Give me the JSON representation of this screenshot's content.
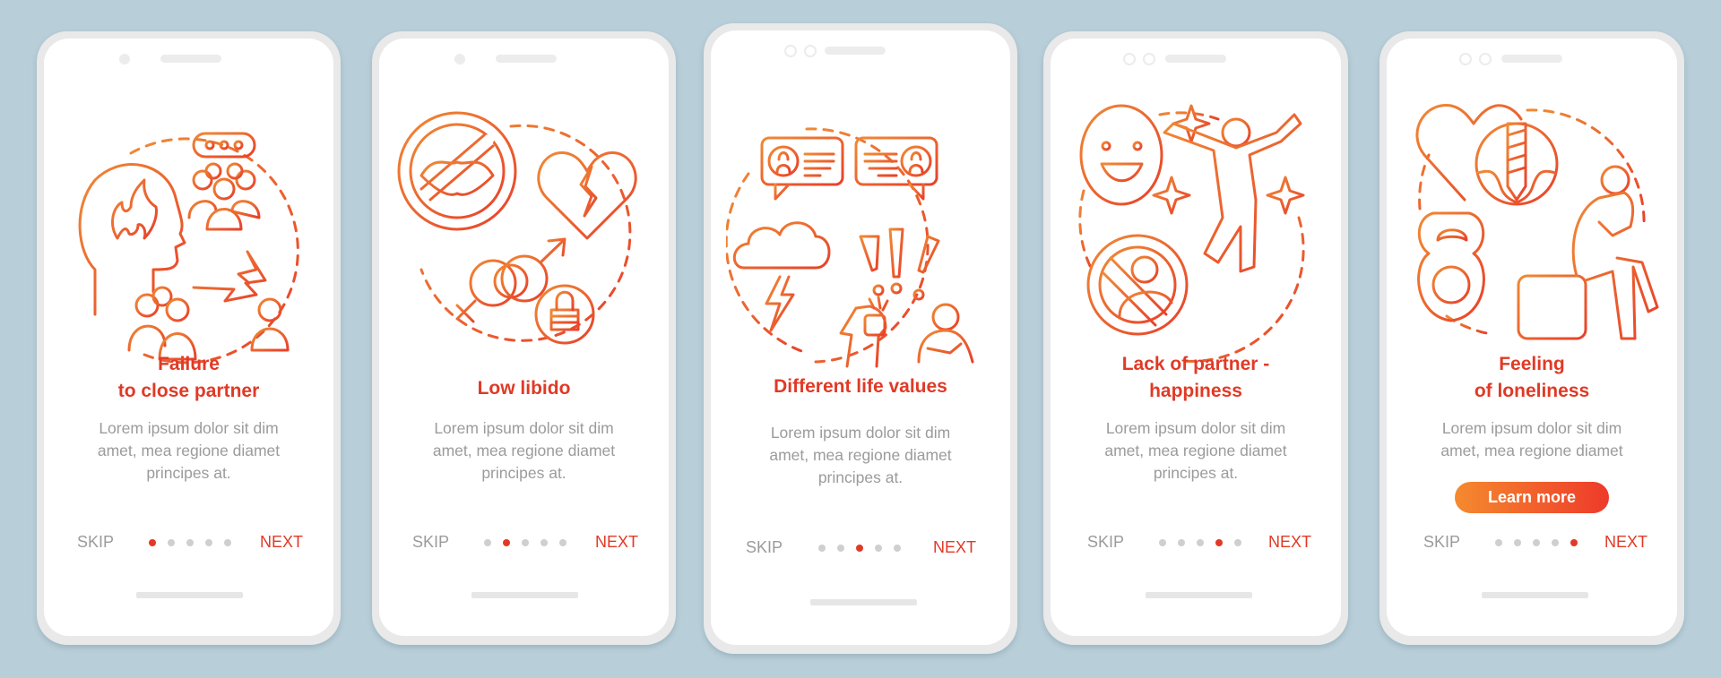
{
  "colors": {
    "background": "#b8ced8",
    "accent": "#e03a26",
    "icon_gradient_start": "#f08a35",
    "icon_gradient_end": "#e8402a",
    "body_text": "#9b9b9b",
    "dot_inactive": "#cfcfcf"
  },
  "screens": [
    {
      "title_lines": [
        "Failure",
        "to close partner"
      ],
      "body_lines": [
        "Lorem ipsum dolor sit dim",
        "amet, mea regione diamet",
        "principes at."
      ],
      "illustration": [
        "head-with-fire-icon",
        "group-with-speech-bubble-icon",
        "lightning-conflict-icon",
        "group-icon",
        "person-icon"
      ],
      "skip_label": "SKIP",
      "next_label": "NEXT",
      "active_page": 1,
      "total_pages": 5
    },
    {
      "title_lines": [
        "Low libido"
      ],
      "body_lines": [
        "Lorem ipsum dolor sit dim",
        "amet, mea regione diamet",
        "principes at."
      ],
      "illustration": [
        "no-kiss-icon",
        "broken-heart-icon",
        "gender-symbols-icon",
        "lock-icon"
      ],
      "skip_label": "SKIP",
      "next_label": "NEXT",
      "active_page": 2,
      "total_pages": 5
    },
    {
      "title_lines": [
        "Different life values"
      ],
      "body_lines": [
        "Lorem ipsum dolor sit dim",
        "amet, mea regione diamet",
        "principes at."
      ],
      "illustration": [
        "profile-chat-bubbles-icon",
        "storm-cloud-icon",
        "exclamation-marks-icon",
        "arguing-people-icon"
      ],
      "skip_label": "SKIP",
      "next_label": "NEXT",
      "active_page": 3,
      "total_pages": 5
    },
    {
      "title_lines": [
        "Lack of partner -",
        "happiness"
      ],
      "body_lines": [
        "Lorem ipsum dolor sit dim",
        "amet, mea regione diamet",
        "principes at."
      ],
      "illustration": [
        "smiley-face-icon",
        "jumping-person-icon",
        "sparkles-icon",
        "no-person-icon"
      ],
      "skip_label": "SKIP",
      "next_label": "NEXT",
      "active_page": 4,
      "total_pages": 5
    },
    {
      "title_lines": [
        "Feeling",
        "of loneliness"
      ],
      "body_lines": [
        "Lorem ipsum dolor sit dim",
        "amet, mea regione diamet"
      ],
      "illustration": [
        "heart-with-drill-icon",
        "kettlebell-icon",
        "sad-sitting-person-icon",
        "box-icon"
      ],
      "button_label": "Learn more",
      "skip_label": "SKIP",
      "next_label": "NEXT",
      "active_page": 5,
      "total_pages": 5
    }
  ]
}
